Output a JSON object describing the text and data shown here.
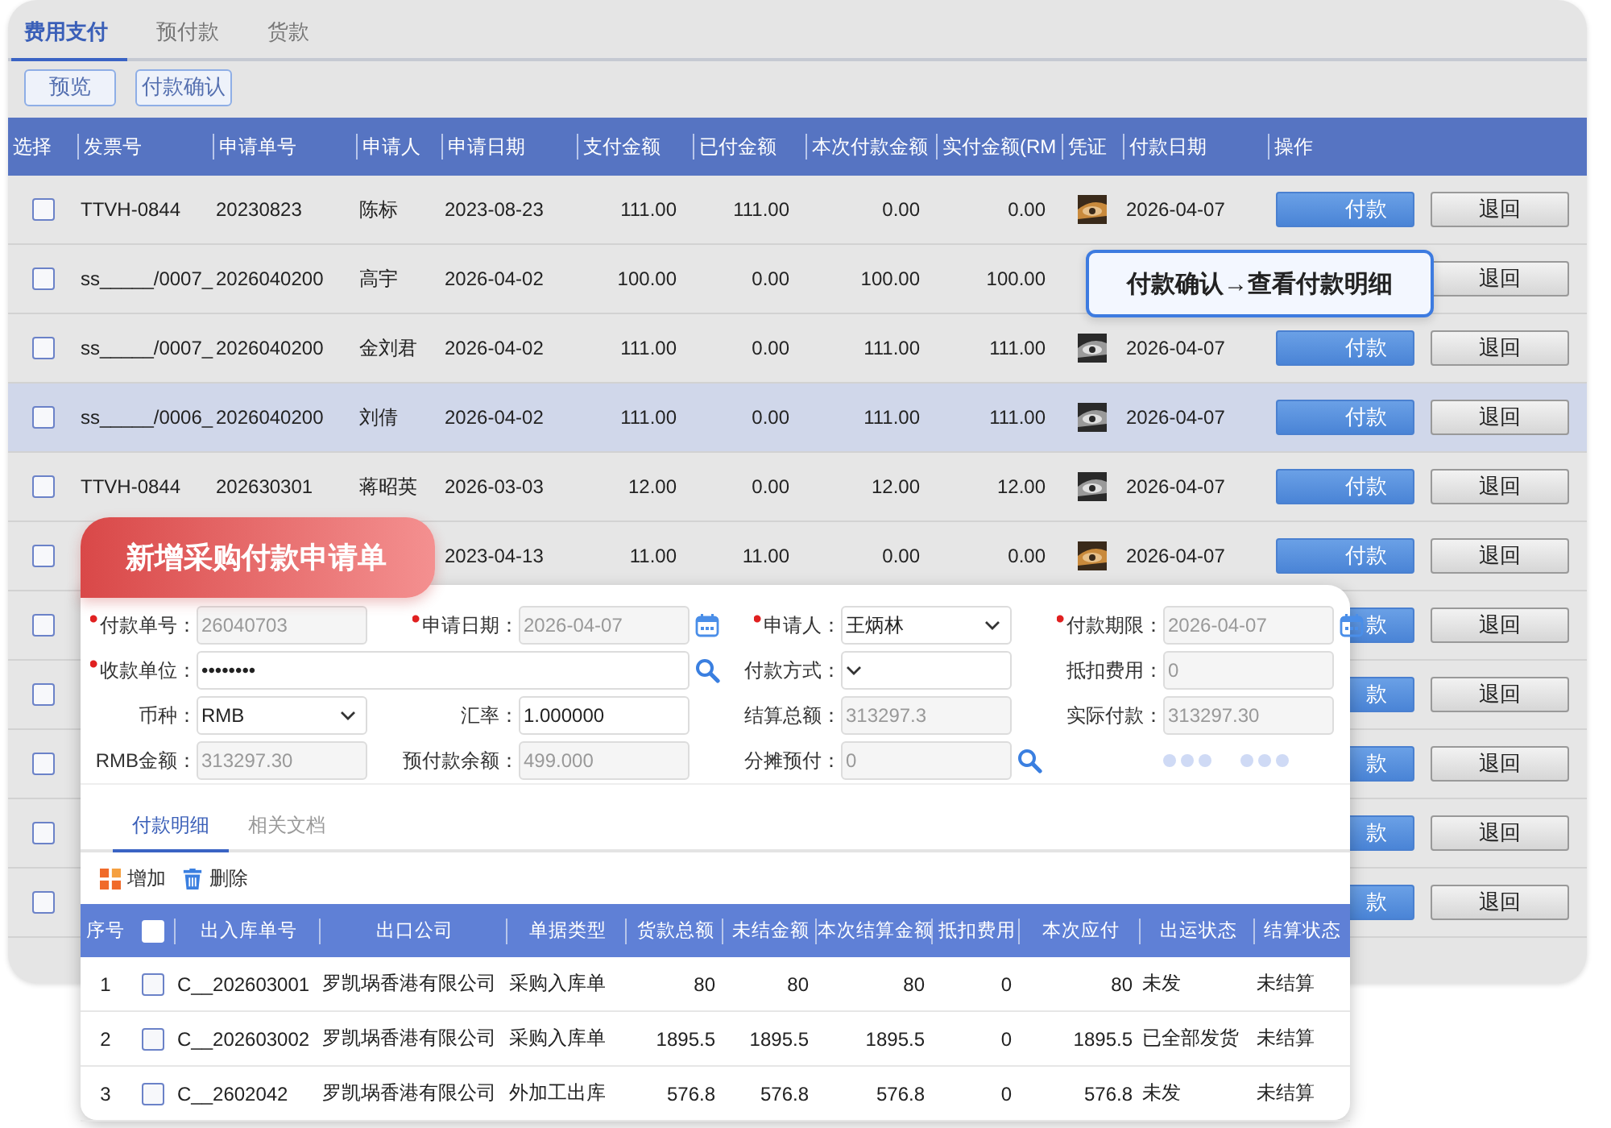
{
  "tabs": [
    {
      "label": "费用支付",
      "selected": true
    },
    {
      "label": "预付款",
      "selected": false
    },
    {
      "label": "货款",
      "selected": false
    }
  ],
  "toolbar": [
    "预览",
    "付款确认"
  ],
  "table": {
    "columns": [
      "选择",
      "发票号",
      "申请单号",
      "申请人",
      "申请日期",
      "支付金额",
      "已付金额",
      "本次付款金额",
      "实付金额(RM",
      "凭证",
      "付款日期",
      "操作"
    ],
    "rows": [
      {
        "checked": false,
        "highlighted": false,
        "invoice": "TTVH-0844",
        "request_no": "20230823",
        "applicant": "陈标",
        "request_date": "2023-08-23",
        "amount": "111.00",
        "paid": "111.00",
        "this_payment": "0.00",
        "actual": "0.00",
        "pay_date": "2026-04-07",
        "pay": "付款",
        "return": "退回"
      },
      {
        "checked": false,
        "highlighted": false,
        "invoice": "ss_____/0007_",
        "request_no": "2026040200",
        "applicant": "高宇",
        "request_date": "2026-04-02",
        "amount": "100.00",
        "paid": "0.00",
        "this_payment": "100.00",
        "actual": "100.00",
        "return": "退回"
      },
      {
        "checked": false,
        "highlighted": false,
        "invoice": "ss_____/0007_",
        "request_no": "2026040200",
        "applicant": "金刘君",
        "request_date": "2026-04-02",
        "amount": "111.00",
        "paid": "0.00",
        "this_payment": "111.00",
        "actual": "111.00",
        "pay_date": "2026-04-07",
        "pay": "付款",
        "return": "退回"
      },
      {
        "checked": false,
        "highlighted": true,
        "invoice": "ss_____/0006_",
        "request_no": "2026040200",
        "applicant": "刘倩",
        "request_date": "2026-04-02",
        "amount": "111.00",
        "paid": "0.00",
        "this_payment": "111.00",
        "actual": "111.00",
        "pay_date": "2026-04-07",
        "pay": "付款",
        "return": "退回"
      },
      {
        "checked": false,
        "highlighted": false,
        "invoice": "TTVH-0844",
        "request_no": "202630301",
        "applicant": "蒋昭英",
        "request_date": "2026-03-03",
        "amount": "12.00",
        "paid": "0.00",
        "this_payment": "12.00",
        "actual": "12.00",
        "pay_date": "2026-04-07",
        "pay": "付款",
        "return": "退回"
      },
      {
        "checked": false,
        "highlighted": false,
        "request_date": "2023-04-13",
        "amount": "11.00",
        "paid": "11.00",
        "this_payment": "0.00",
        "actual": "0.00",
        "pay_date": "2026-04-07",
        "pay": "付款",
        "return": "退回"
      },
      {
        "checked": false,
        "highlighted": false,
        "pay": "款",
        "return": "退回"
      },
      {
        "checked": false,
        "highlighted": false,
        "pay": "款",
        "return": "退回"
      },
      {
        "checked": false,
        "highlighted": false,
        "pay": "款",
        "return": "退回"
      },
      {
        "checked": false,
        "highlighted": false,
        "pay": "款",
        "return": "退回"
      },
      {
        "checked": false,
        "highlighted": false,
        "pay": "款",
        "return": "退回"
      }
    ]
  },
  "callout": "付款确认→查看付款明细",
  "dialog": {
    "title": "新增采购付款申请单",
    "form": [
      {
        "kind": "readonly",
        "label": "付款单号：",
        "required": true,
        "value": "26040703"
      },
      {
        "kind": "readonly",
        "label": "申请日期：",
        "required": true,
        "value": "2026-04-07"
      },
      {
        "kind": "select",
        "label": "申请人：",
        "required": true,
        "value": "王炳林"
      },
      {
        "kind": "readonly",
        "label": "付款期限：",
        "required": true,
        "value": "2026-04-07"
      },
      {
        "kind": "text",
        "label": "收款单位：",
        "required": true,
        "value": "••••••••",
        "wide": true
      },
      {
        "kind": "select",
        "label": "付款方式：",
        "required": false
      },
      {
        "kind": "readonly",
        "label": "抵扣费用：",
        "required": false,
        "value": "0"
      },
      {
        "kind": "select",
        "label": "币种：",
        "required": false,
        "value": "RMB"
      },
      {
        "kind": "text",
        "label": "汇率：",
        "required": false,
        "value": "1.000000"
      },
      {
        "kind": "readonly",
        "label": "结算总额：",
        "required": false,
        "value": "313297.3"
      },
      {
        "kind": "readonly",
        "label": "实际付款：",
        "required": false,
        "value": "313297.30"
      },
      {
        "kind": "readonly",
        "label": "RMB金额：",
        "required": false,
        "value": "313297.30"
      },
      {
        "kind": "readonly",
        "label": "预付款余额：",
        "required": false,
        "value": "499.000"
      },
      {
        "kind": "readonly",
        "label": "分摊预付：",
        "required": false,
        "value": "0"
      },
      {
        "kind": "dots"
      }
    ],
    "tabs": [
      {
        "label": "付款明细",
        "selected": true
      },
      {
        "label": "相关文档",
        "selected": false
      }
    ],
    "actions": [
      {
        "kind": "add",
        "label": "增加"
      },
      {
        "kind": "delete",
        "label": "删除"
      }
    ],
    "grid": {
      "header_checked": false,
      "columns": [
        "序号",
        "出入库单号",
        "出口公司",
        "单据类型",
        "货款总额",
        "未结金额",
        "本次结算金额",
        "抵扣费用",
        "本次应付",
        "出运状态",
        "结算状态"
      ],
      "rows": [
        {
          "seq": "1",
          "checked": false,
          "no": "C__202603001",
          "company": "罗凯埚香港有限公司",
          "type": "采购入库单",
          "total": "80",
          "unsettled": "80",
          "settle": "80",
          "deduct": "0",
          "payable": "80",
          "shipping": "未发",
          "status": "未结算"
        },
        {
          "seq": "2",
          "checked": false,
          "no": "C__202603002",
          "company": "罗凯埚香港有限公司",
          "type": "采购入库单",
          "total": "1895.5",
          "unsettled": "1895.5",
          "settle": "1895.5",
          "deduct": "0",
          "payable": "1895.5",
          "shipping": "已全部发货",
          "status": "未结算"
        },
        {
          "seq": "3",
          "checked": false,
          "no": "C__2602042",
          "company": "罗凯埚香港有限公司",
          "type": "外加工出库",
          "total": "576.8",
          "unsettled": "576.8",
          "settle": "576.8",
          "deduct": "0",
          "payable": "576.8",
          "shipping": "未发",
          "status": "未结算"
        }
      ]
    }
  }
}
